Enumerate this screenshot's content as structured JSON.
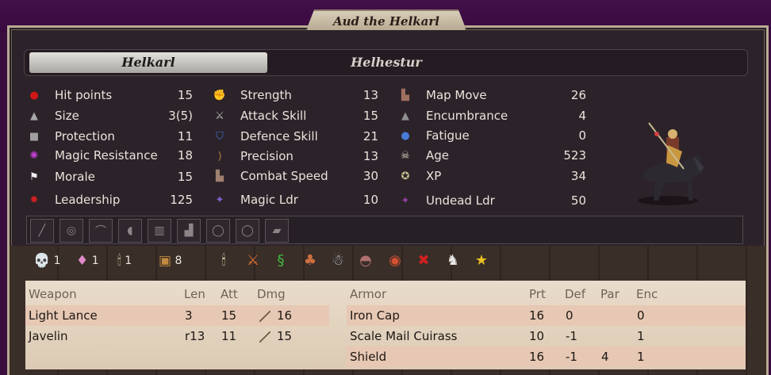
{
  "title": "Aud the Helkarl",
  "tabs": [
    {
      "label": "Helkarl",
      "active": true
    },
    {
      "label": "Helhestur",
      "active": false
    }
  ],
  "stats": {
    "col1": [
      {
        "icon": "blood-drop-icon",
        "label": "Hit points",
        "value": "15"
      },
      {
        "icon": "size-icon",
        "label": "Size",
        "value": "3(5)"
      },
      {
        "icon": "armor-icon",
        "label": "Protection",
        "value": "11"
      },
      {
        "icon": "magic-swirl-icon",
        "label": "Magic Resistance",
        "value": "18"
      },
      {
        "icon": "white-flag-icon",
        "label": "Morale",
        "value": "15"
      },
      {
        "icon": "leadership-star-icon",
        "label": "Leadership",
        "value": "125"
      }
    ],
    "col2": [
      {
        "icon": "strength-arm-icon",
        "label": "Strength",
        "value": "13"
      },
      {
        "icon": "sword-icon",
        "label": "Attack Skill",
        "value": "15"
      },
      {
        "icon": "shield-icon",
        "label": "Defence Skill",
        "value": "21"
      },
      {
        "icon": "bow-icon",
        "label": "Precision",
        "value": "13"
      },
      {
        "icon": "boots-icon",
        "label": "Combat Speed",
        "value": "30"
      },
      {
        "icon": "magic-leader-icon",
        "label": "Magic Ldr",
        "value": "10"
      }
    ],
    "col3": [
      {
        "icon": "map-boots-icon",
        "label": "Map Move",
        "value": "26"
      },
      {
        "icon": "weight-icon",
        "label": "Encumbrance",
        "value": "4"
      },
      {
        "icon": "sweat-drop-icon",
        "label": "Fatigue",
        "value": "0"
      },
      {
        "icon": "skull-icon",
        "label": "Age",
        "value": "523"
      },
      {
        "icon": "xp-star-icon",
        "label": "XP",
        "value": "34"
      },
      {
        "icon": "undead-leader-icon",
        "label": "Undead Ldr",
        "value": "50"
      }
    ]
  },
  "slots": [
    "weapon-slot-icon",
    "shield-slot-icon",
    "bow-slot-icon",
    "helmet-slot-icon",
    "armor-slot-icon",
    "boots-slot-icon",
    "ring-slot-icon",
    "ring-slot-icon",
    "misc-slot-icon"
  ],
  "resources": [
    {
      "icon": "death-gem-icon",
      "count": "1",
      "glyph": "💀",
      "color": "#c070e0"
    },
    {
      "icon": "astral-gem-icon",
      "count": "1",
      "glyph": "♦",
      "color": "#e08ac8"
    },
    {
      "icon": "candelabra-icon",
      "count": "1",
      "glyph": "🕯",
      "color": "#f0e6b0"
    },
    {
      "icon": "treasure-icon",
      "count": "8",
      "glyph": "▣",
      "color": "#c08a40"
    }
  ],
  "buffs": [
    {
      "icon": "candelabra-icon",
      "glyph": "🕯",
      "color": "#f0e6b0"
    },
    {
      "icon": "flaming-sword-icon",
      "glyph": "⚔",
      "color": "#e07030"
    },
    {
      "icon": "green-serpent-icon",
      "glyph": "§",
      "color": "#40c040"
    },
    {
      "icon": "fire-figure-icon",
      "glyph": "♣",
      "color": "#d07040"
    },
    {
      "icon": "twin-spirits-icon",
      "glyph": "☃",
      "color": "#b0c8d8"
    },
    {
      "icon": "beast-icon",
      "glyph": "◓",
      "color": "#b07070"
    },
    {
      "icon": "eye-icon",
      "glyph": "◉",
      "color": "#d05030"
    },
    {
      "icon": "red-cross-icon",
      "glyph": "✖",
      "color": "#d02020"
    },
    {
      "icon": "white-horse-icon",
      "glyph": "♞",
      "color": "#e8e8e8"
    },
    {
      "icon": "gold-star-icon",
      "glyph": "★",
      "color": "#e8c020"
    }
  ],
  "weapons": {
    "headers": {
      "name": "Weapon",
      "len": "Len",
      "att": "Att",
      "dmg": "Dmg"
    },
    "rows": [
      {
        "name": "Light Lance",
        "len": "3",
        "att": "15",
        "dmg": "16"
      },
      {
        "name": "Javelin",
        "len": "r13",
        "att": "11",
        "dmg": "15"
      }
    ]
  },
  "armor": {
    "headers": {
      "name": "Armor",
      "prt": "Prt",
      "def": "Def",
      "par": "Par",
      "enc": "Enc"
    },
    "rows": [
      {
        "name": "Iron Cap",
        "prt": "16",
        "def": "0",
        "par": "",
        "enc": "0"
      },
      {
        "name": "Scale Mail Cuirass",
        "prt": "10",
        "def": "-1",
        "par": "",
        "enc": "1"
      },
      {
        "name": "Shield",
        "prt": "16",
        "def": "-1",
        "par": "4",
        "enc": "1"
      }
    ]
  }
}
